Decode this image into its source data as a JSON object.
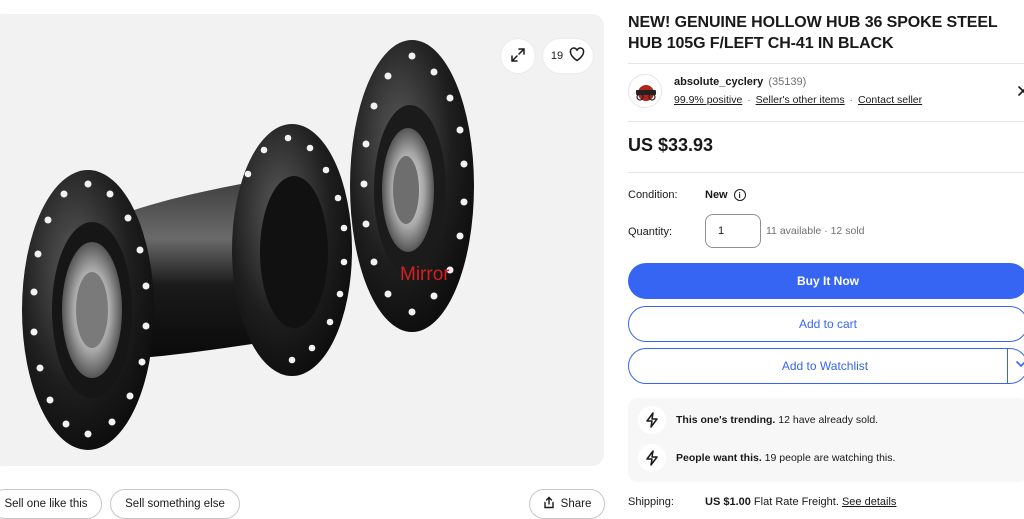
{
  "gallery": {
    "watch_count": "19",
    "mirror_label": "Mirror",
    "buttons": {
      "sell_one": "Sell one like this",
      "sell_else": "Sell something else",
      "share": "Share"
    }
  },
  "item": {
    "title": "NEW! GENUINE HOLLOW HUB 36 SPOKE STEEL HUB 105G F/LEFT CH-41 IN BLACK",
    "price": "US $33.93"
  },
  "seller": {
    "name": "absolute_cyclery",
    "feedback_count": "(35139)",
    "positive": "99.9% positive",
    "other_items": "Seller's other items",
    "contact": "Contact seller",
    "separator": "·"
  },
  "condition": {
    "label": "Condition:",
    "value": "New"
  },
  "quantity": {
    "label": "Quantity:",
    "value": "1",
    "availability": "11 available · 12 sold"
  },
  "actions": {
    "buy_now": "Buy It Now",
    "add_to_cart": "Add to cart",
    "add_to_watchlist": "Add to Watchlist"
  },
  "trending": {
    "row1_bold": "This one's trending.",
    "row1_text": " 12 have already sold.",
    "row2_bold": "People want this.",
    "row2_text": " 19 people are watching this."
  },
  "shipping": {
    "label": "Shipping:",
    "amount": "US $1.00",
    "method": " Flat Rate Freight. ",
    "details_link": "See details"
  },
  "colors": {
    "accent": "#3665f3",
    "mirror_text": "#d42020"
  },
  "icons": {
    "expand": "expand-icon",
    "heart": "heart-icon",
    "share": "share-icon",
    "info": "info-icon",
    "lightning": "lightning-icon",
    "chevron": "chevron-down-icon",
    "close": "close-icon"
  }
}
